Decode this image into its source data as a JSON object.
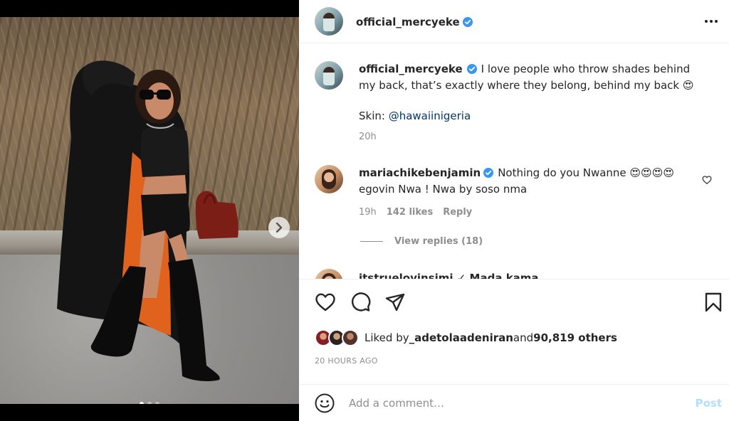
{
  "post": {
    "username": "official_mercyeke",
    "caption": "I love people who throw shades behind my back, that’s exactly where they belong, behind my back 😍",
    "skin_label": "Skin: ",
    "skin_handle": "@hawaiinigeria",
    "caption_time": "20h"
  },
  "comments": [
    {
      "username": "mariachikebenjamin",
      "text": "Nothing do you Nwanne 😍😍😍😍 egovin Nwa ! Nwa by soso nma",
      "time": "19h",
      "likes": "142 likes",
      "reply": "Reply",
      "view_replies": "View replies (18)"
    }
  ],
  "cut_comment": "itstruelovinsimi ✓ Mada kama",
  "likes": {
    "prefix": "Liked by ",
    "user": "_adetolaadeniran",
    "middle": " and ",
    "count": "90,819 others"
  },
  "time_ago": "20 HOURS AGO",
  "comment_box": {
    "placeholder": "Add a comment…",
    "post_label": "Post"
  },
  "carousel": {
    "slides": 3,
    "active": 1
  },
  "colors": {
    "verified": "#3897f0",
    "link": "#00376b",
    "post_disabled": "#b2dffc"
  }
}
